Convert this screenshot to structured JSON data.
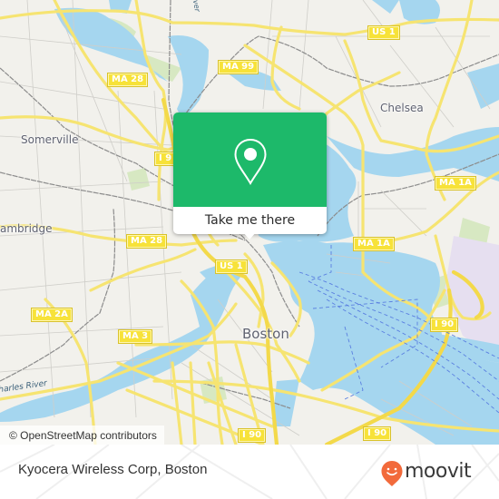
{
  "map": {
    "colors": {
      "land": "#f2f1ec",
      "water": "#a5d6ef",
      "park": "#d7e8c2",
      "road_major": "#f6e471",
      "road_minor": "#c9c9c6",
      "rail": "#8a8a8a",
      "ferry": "#5a7fe0",
      "airport": "#e6dff0"
    },
    "place_labels": [
      {
        "id": "somerville",
        "text": "Somerville"
      },
      {
        "id": "cambridge",
        "text": "ambridge"
      },
      {
        "id": "chelsea",
        "text": "Chelsea"
      },
      {
        "id": "boston",
        "text": "Boston"
      }
    ],
    "water_labels": [
      {
        "id": "charles-river",
        "text": "Charles River"
      },
      {
        "id": "mystic-river",
        "text": "ver"
      }
    ],
    "route_shields": [
      {
        "id": "us1-north",
        "text": "US 1"
      },
      {
        "id": "ma99",
        "text": "MA 99"
      },
      {
        "id": "ma28-north",
        "text": "MA 28"
      },
      {
        "id": "i93",
        "text": "I 9"
      },
      {
        "id": "ma28-south",
        "text": "MA 28"
      },
      {
        "id": "ma1a-east",
        "text": "MA 1A"
      },
      {
        "id": "ma1a-south",
        "text": "MA 1A"
      },
      {
        "id": "us1-south",
        "text": "US 1"
      },
      {
        "id": "ma2a",
        "text": "MA 2A"
      },
      {
        "id": "ma3",
        "text": "MA 3"
      },
      {
        "id": "i90-east",
        "text": "I 90"
      },
      {
        "id": "i90-south",
        "text": "I 90"
      },
      {
        "id": "i90-southeast",
        "text": "I 90"
      }
    ],
    "attribution": "© OpenStreetMap contributors"
  },
  "popup": {
    "accent_color": "#1db96a",
    "icon": "map-pin-icon",
    "cta_label": "Take me there"
  },
  "footer": {
    "place_name": "Kyocera Wireless Corp, Boston",
    "brand": {
      "name": "moovit",
      "logo_color": "#f26a3b",
      "icon": "moovit-smile-pin-icon"
    }
  }
}
